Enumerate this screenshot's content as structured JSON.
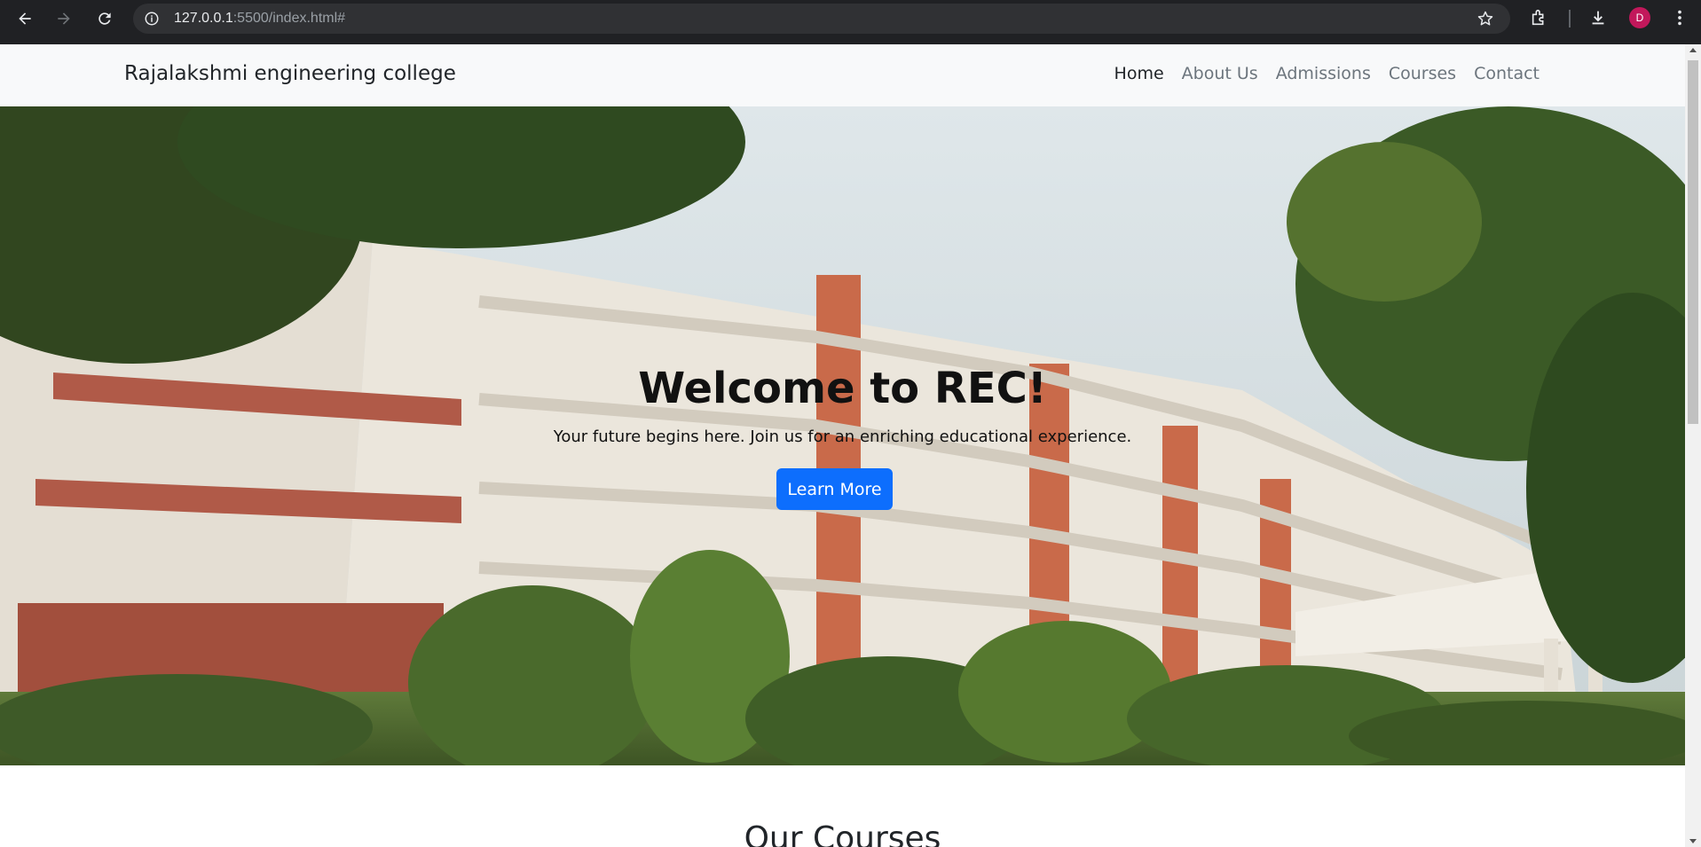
{
  "browser": {
    "url_host": "127.0.0.1",
    "url_rest": ":5500/index.html#",
    "avatar_letter": "D"
  },
  "navbar": {
    "brand": "Rajalakshmi engineering college",
    "links": [
      {
        "label": "Home",
        "active": true
      },
      {
        "label": "About Us",
        "active": false
      },
      {
        "label": "Admissions",
        "active": false
      },
      {
        "label": "Courses",
        "active": false
      },
      {
        "label": "Contact",
        "active": false
      }
    ]
  },
  "hero": {
    "title": "Welcome to REC!",
    "subtitle": "Your future begins here. Join us for an enriching educational experience.",
    "button_label": "Learn More"
  },
  "courses": {
    "title": "Our Courses"
  },
  "colors": {
    "primary": "#0d6efd",
    "navbar_bg": "#f8f9fa",
    "chrome_bg": "#202124",
    "avatar": "#c2185b"
  }
}
